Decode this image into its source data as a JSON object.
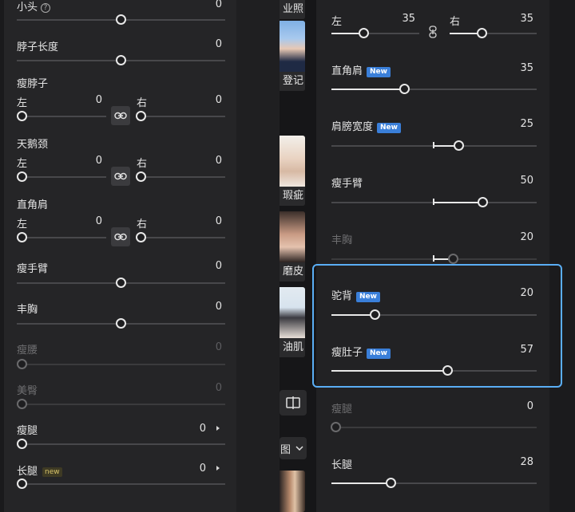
{
  "left_panel": {
    "small_head": {
      "label": "小头",
      "value": "0"
    },
    "neck_length": {
      "label": "脖子长度",
      "value": "0"
    },
    "thin_neck": {
      "label": "瘦脖子",
      "left_label": "左",
      "left_value": "0",
      "right_label": "右",
      "right_value": "0"
    },
    "swan_neck": {
      "label": "天鹅颈",
      "left_label": "左",
      "left_value": "0",
      "right_label": "右",
      "right_value": "0"
    },
    "square_shoulder": {
      "label": "直角肩",
      "left_label": "左",
      "left_value": "0",
      "right_label": "右",
      "right_value": "0"
    },
    "thin_arm": {
      "label": "瘦手臂",
      "value": "0"
    },
    "full_chest": {
      "label": "丰胸",
      "value": "0"
    },
    "thin_waist": {
      "label": "瘦腰",
      "value": "0"
    },
    "hip": {
      "label": "美臀",
      "value": "0"
    },
    "thin_leg": {
      "label": "瘦腿",
      "value": "0"
    },
    "long_leg": {
      "label": "长腿",
      "badge": "new",
      "value": "0"
    }
  },
  "middle_strip": {
    "thumbs": [
      "业照",
      "登记",
      "瑕疵",
      "磨皮",
      "油肌"
    ],
    "mode_label": "图"
  },
  "right_panel": {
    "top_pair": {
      "left_label": "左",
      "left_value": "35",
      "right_label": "右",
      "right_value": "35"
    },
    "square_shoulder": {
      "label": "直角肩",
      "badge": "New",
      "value": "35",
      "level": 35
    },
    "shoulder_width": {
      "label": "肩膀宽度",
      "badge": "New",
      "value": "25",
      "level": 25
    },
    "thin_arm": {
      "label": "瘦手臂",
      "value": "50",
      "level": 50
    },
    "full_chest": {
      "label": "丰胸",
      "value": "20",
      "level": 20
    },
    "hunchback": {
      "label": "驼背",
      "badge": "New",
      "value": "20",
      "level": 20
    },
    "thin_belly": {
      "label": "瘦肚子",
      "badge": "New",
      "value": "57",
      "level": 57
    },
    "thin_leg": {
      "label": "瘦腿",
      "value": "0",
      "level": 0
    },
    "long_leg": {
      "label": "长腿",
      "value": "28",
      "level": 28
    }
  },
  "colors": {
    "highlight": "#5aaef5",
    "badge_blue": "#3a7fd9"
  }
}
